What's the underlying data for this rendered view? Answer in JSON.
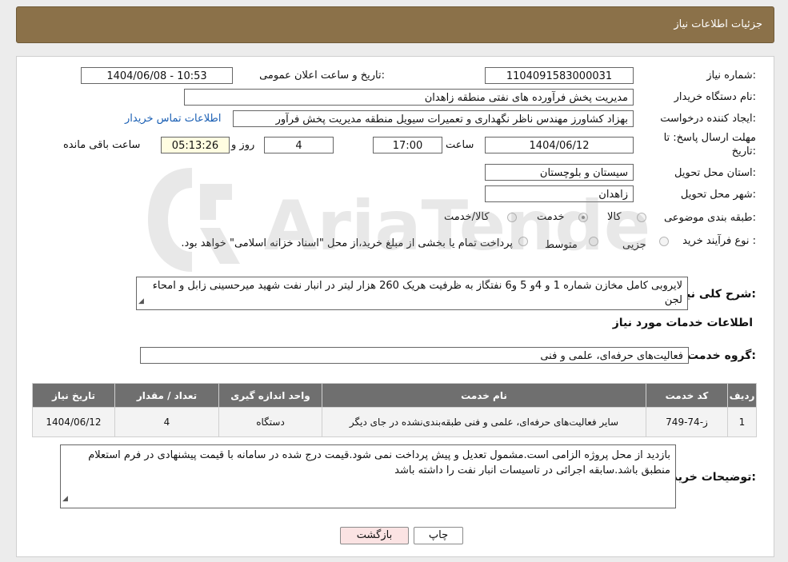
{
  "header": {
    "title": "جزئیات اطلاعات نیاز"
  },
  "fields": {
    "need_number_label": "شماره نیاز:",
    "need_number": "1104091583000031",
    "announce_label": "تاریخ و ساعت اعلان عمومی:",
    "announce_value": "1404/06/08 - 10:53",
    "buyer_org_label": "نام دستگاه خریدار:",
    "buyer_org": "مدیریت پخش فرآورده های نفتی منطقه زاهدان",
    "creator_label": "ایجاد کننده درخواست:",
    "creator": "بهزاد کشاورز مهندس ناظر نگهداری و تعمیرات سیویل منطقه  مدیریت پخش فرآور",
    "contact_link": "اطلاعات تماس خریدار",
    "deadline_label_1": "مهلت ارسال پاسخ: تا",
    "deadline_label_2": "تاریخ:",
    "deadline_date": "1404/06/12",
    "time_label": "ساعت",
    "deadline_time": "17:00",
    "days_value": "4",
    "days_label": "روز و",
    "remaining_time": "05:13:26",
    "remaining_label": "ساعت باقی مانده",
    "province_label": "استان محل تحویل:",
    "province": "سیستان و بلوچستان",
    "city_label": "شهر محل تحویل:",
    "city": "زاهدان",
    "category_label": "طبقه بندی موضوعی:",
    "category_options": [
      "کالا",
      "خدمت",
      "کالا/خدمت"
    ],
    "process_label": "نوع فرآیند خرید :",
    "process_options": [
      "جزیی",
      "متوسط"
    ],
    "process_note": "پرداخت تمام یا بخشی از مبلغ خرید،از محل \"اسناد خزانه اسلامی\" خواهد بود.",
    "summary_label": "شرح کلی نیاز:",
    "summary": "لایروبی کامل مخازن شماره 1 و 4و 5 و6 نفتگاز به ظرفیت  هریک 260 هزار لیتر در انبار نفت شهید میرحسینی زابل و امحاء لجن",
    "services_heading": "اطلاعات خدمات مورد نیاز",
    "service_group_label": "گروه خدمت:",
    "service_group": "فعالیت‌های حرفه‌ای، علمی و فنی",
    "buyer_notes_label": "توضیحات خریدار:",
    "buyer_notes": "بازدید از محل پروژه الزامی است.مشمول تعدیل و پیش پرداخت نمی شود.قیمت درج شده در سامانه با قیمت پیشنهادی در فرم استعلام منطبق باشد.سابقه اجرائی در تاسیسات انبار نفت را داشته باشد"
  },
  "table": {
    "headers": [
      "ردیف",
      "کد خدمت",
      "نام خدمت",
      "واحد اندازه گیری",
      "تعداد / مقدار",
      "تاریخ نیاز"
    ],
    "rows": [
      [
        "1",
        "ز-74-749",
        "سایر فعالیت‌های حرفه‌ای، علمی و فنی طبقه‌بندی‌نشده در جای دیگر",
        "دستگاه",
        "4",
        "1404/06/12"
      ]
    ]
  },
  "buttons": {
    "print": "چاپ",
    "back": "بازگشت"
  },
  "watermark": {
    "text": "AriaTender.neT"
  },
  "colors": {
    "header_bg": "#8b7149",
    "table_header_bg": "#6f6f6f",
    "back_button_bg": "#fbe3e3",
    "link": "#1a5fb4"
  }
}
